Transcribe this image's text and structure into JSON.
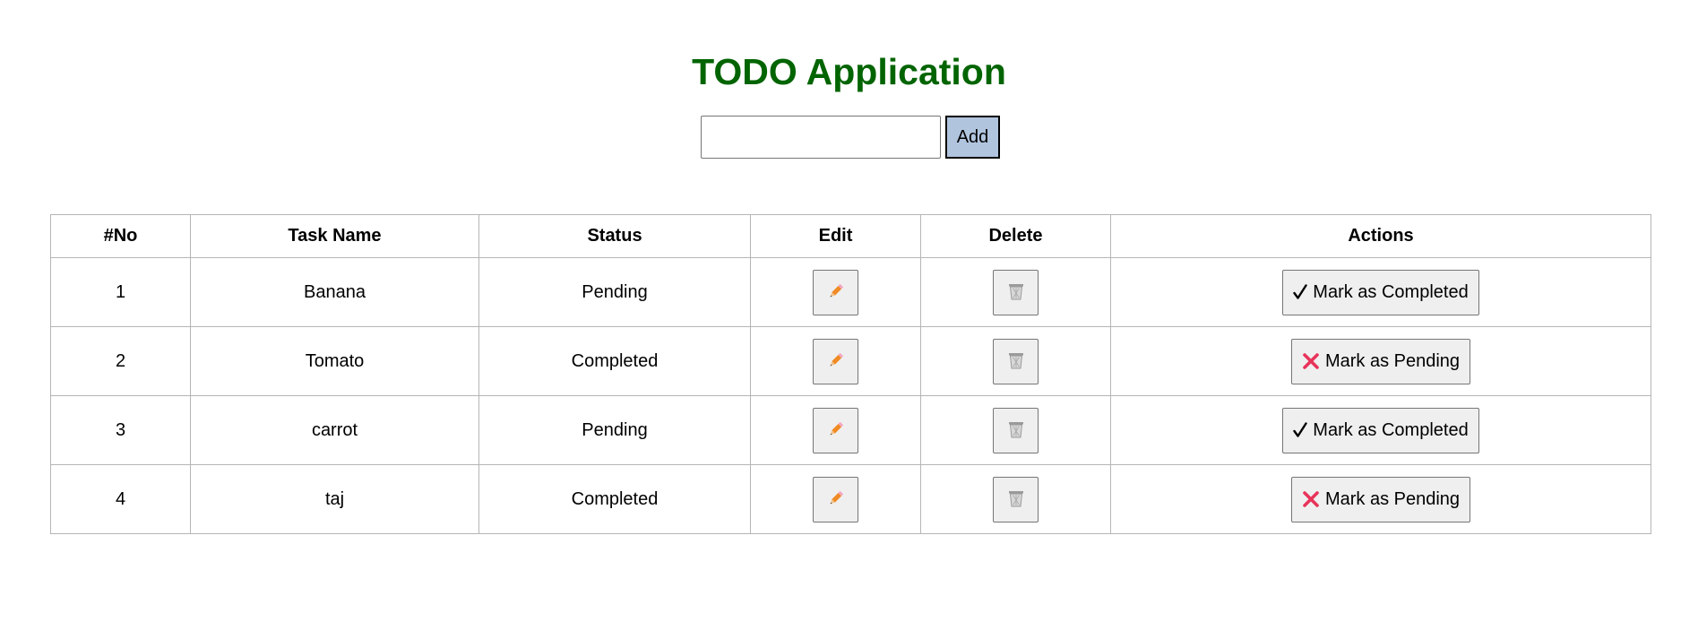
{
  "page": {
    "title": "TODO Application"
  },
  "add_form": {
    "input_value": "",
    "placeholder": "",
    "add_label": "Add"
  },
  "table": {
    "headers": [
      "#No",
      "Task Name",
      "Status",
      "Edit",
      "Delete",
      "Actions"
    ],
    "rows": [
      {
        "no": "1",
        "name": "Banana",
        "status": "Pending",
        "action_label": "Mark as Completed",
        "action_icon": "checkmark-icon"
      },
      {
        "no": "2",
        "name": "Tomato",
        "status": "Completed",
        "action_label": "Mark as Pending",
        "action_icon": "cross-icon"
      },
      {
        "no": "3",
        "name": "carrot",
        "status": "Pending",
        "action_label": "Mark as Completed",
        "action_icon": "checkmark-icon"
      },
      {
        "no": "4",
        "name": "taj",
        "status": "Completed",
        "action_label": "Mark as Pending",
        "action_icon": "cross-icon"
      }
    ]
  },
  "icons": {
    "edit": "pencil-icon",
    "delete": "trash-icon"
  },
  "colors": {
    "title": "#006400",
    "add_button_bg": "#b0c4de",
    "pencil": "#f08a24",
    "cross": "#e8345a",
    "trash": "#9a9a9a"
  }
}
